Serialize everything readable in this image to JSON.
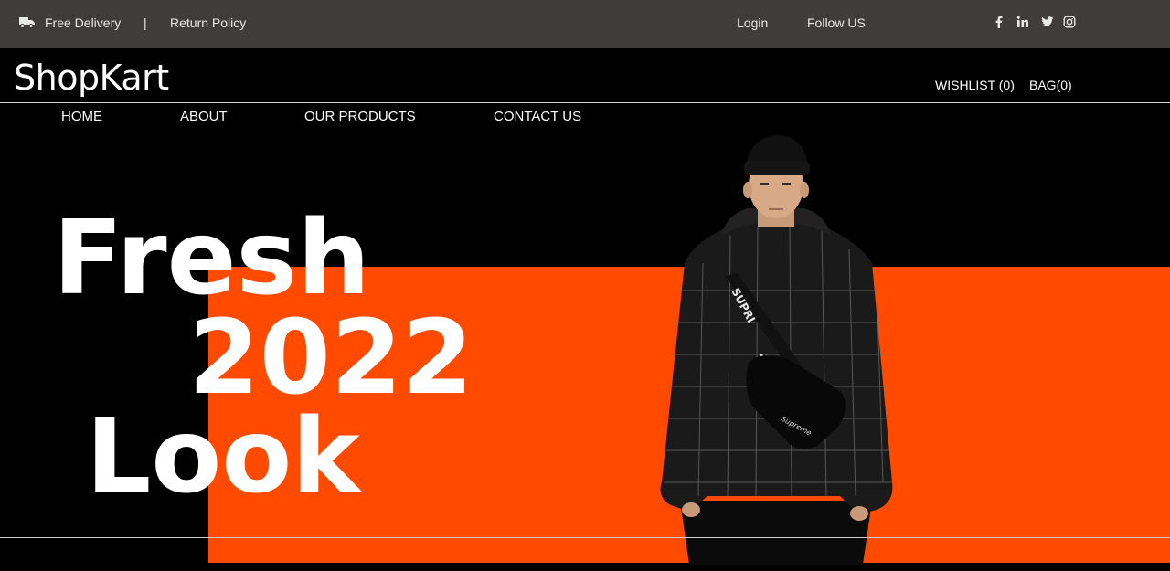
{
  "colors": {
    "topbar_bg": "#403c3c",
    "accent_orange": "#ff4a00",
    "background": "#000000",
    "text_light": "#ffffff"
  },
  "topbar": {
    "delivery_icon": "truck-icon",
    "free_delivery": "Free Delivery",
    "separator": "|",
    "return_policy": "Return Policy",
    "login": "Login",
    "follow_us": "Follow US",
    "social_icons": [
      "facebook-icon",
      "linkedin-icon",
      "twitter-icon",
      "instagram-icon"
    ]
  },
  "header": {
    "logo": "ShopKart",
    "wishlist": "WISHLIST (0)",
    "bag": "BAG(0)"
  },
  "nav": {
    "items": [
      "HOME",
      "ABOUT",
      "OUR PRODUCTS",
      "CONTACT US"
    ]
  },
  "hero": {
    "line1": "Fresh",
    "line2": "2022",
    "line3": "Look",
    "image": "model-in-black-jacket-photo"
  }
}
